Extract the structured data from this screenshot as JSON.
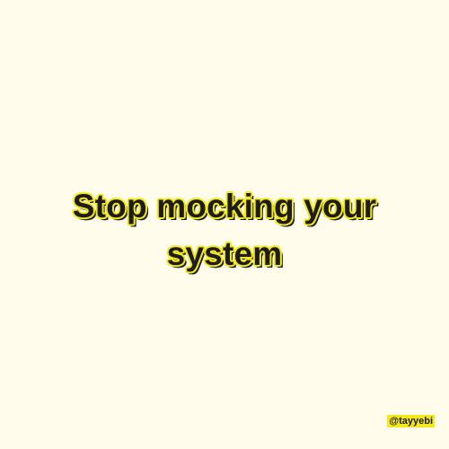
{
  "post": {
    "headline_line1": "Stop mocking your",
    "headline_line2": "system",
    "handle": "@tayyebi"
  },
  "colors": {
    "background": "#fffcec",
    "text": "#1c1c1c",
    "accent_outline": "#f4e81c"
  }
}
